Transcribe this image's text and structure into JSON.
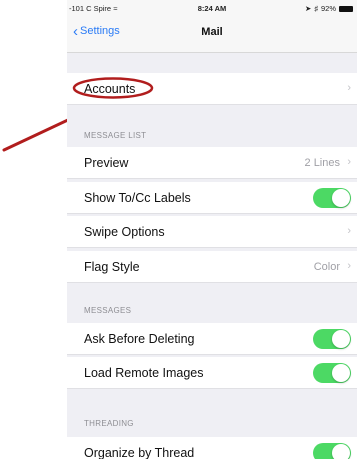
{
  "status_bar": {
    "carrier": "-101 C Spire",
    "time": "8:24 AM",
    "battery": "92%"
  },
  "nav": {
    "back_label": "Settings",
    "title": "Mail"
  },
  "accounts": {
    "label": "Accounts"
  },
  "sections": {
    "message_list": "MESSAGE LIST",
    "messages": "MESSAGES",
    "threading": "THREADING"
  },
  "rows": {
    "preview": {
      "label": "Preview",
      "value": "2 Lines"
    },
    "show_to_cc": {
      "label": "Show To/Cc Labels",
      "on": true
    },
    "swipe_options": {
      "label": "Swipe Options"
    },
    "flag_style": {
      "label": "Flag Style",
      "value": "Color"
    },
    "ask_before_deleting": {
      "label": "Ask Before Deleting",
      "on": true
    },
    "load_remote_images": {
      "label": "Load Remote Images",
      "on": true
    },
    "organize_by_thread": {
      "label": "Organize by Thread",
      "on": true
    }
  },
  "colors": {
    "accent": "#2a7bf6",
    "toggle_on": "#4cd964",
    "annotation": "#b11d1d"
  }
}
